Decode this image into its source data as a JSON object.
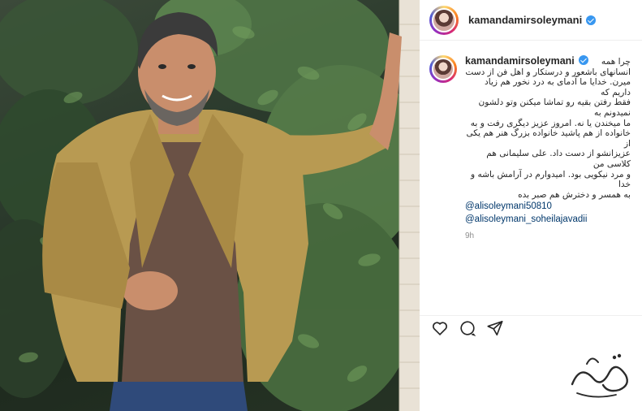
{
  "post": {
    "username": "kamandamirsoleymani",
    "verified": true
  },
  "comment": {
    "username": "kamandamirsoleymani",
    "caption_lines": [
      "چرا همه",
      "انسانهای باشعور و درستکار و اهل فن از دست",
      "میرن. خدایا ما آدمای به درد نخور هم زیاد داریم که",
      "فقط رفتن بقیه رو تماشا میکنن وتو دلشون نمیدونم به",
      "ما میخندن یا نه. امروز عزیز دیگری رفت و به",
      "خانواده از هم پاشید خانواده بزرگ هنر هم یکی از",
      "عزیزانشو از دست داد. علی سلیمانی هم کلاسی من",
      "و مرد نیکویی بود. امیدوارم در آرامش باشه و خدا",
      "به همسر و دخترش هم صبر بده"
    ],
    "mentions": [
      "@alisoleymani50810",
      "@alisoleymani_soheilajavadii"
    ],
    "timestamp": "9h"
  },
  "actions": {
    "like_icon": "heart-icon",
    "comment_icon": "comment-bubble-icon",
    "share_icon": "paper-plane-icon"
  },
  "colors": {
    "link": "#00376b",
    "verified_badge": "#3897f0",
    "muted": "#8e8e8e",
    "jacket": "#b89a52"
  }
}
